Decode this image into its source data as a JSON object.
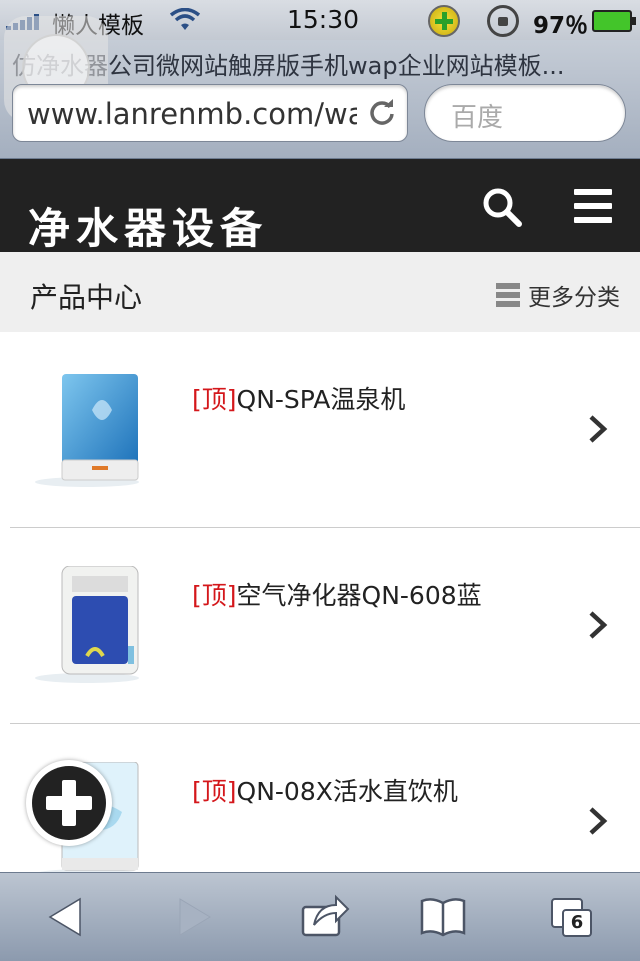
{
  "status_bar": {
    "carrier": "懒人模板",
    "time": "15:30",
    "battery_percent": "97％"
  },
  "browser": {
    "page_title": "仿净水器公司微网站触屏版手机wap企业网站模板...",
    "url": "www.lanrenmb.com/wap",
    "search_placeholder": "百度",
    "open_tabs": "6"
  },
  "site": {
    "logo_text": "净水器设备"
  },
  "category_bar": {
    "title": "产品中心",
    "more_label": "更多分类"
  },
  "products": [
    {
      "pin": "[顶]",
      "name": "QN-SPA温泉机"
    },
    {
      "pin": "[顶]",
      "name": "空气净化器QN-608蓝"
    },
    {
      "pin": "[顶]",
      "name": "QN-08X活水直饮机"
    }
  ],
  "colors": {
    "header_bg": "#222222",
    "pin_red": "#d4171b",
    "category_bg": "#efefef"
  }
}
